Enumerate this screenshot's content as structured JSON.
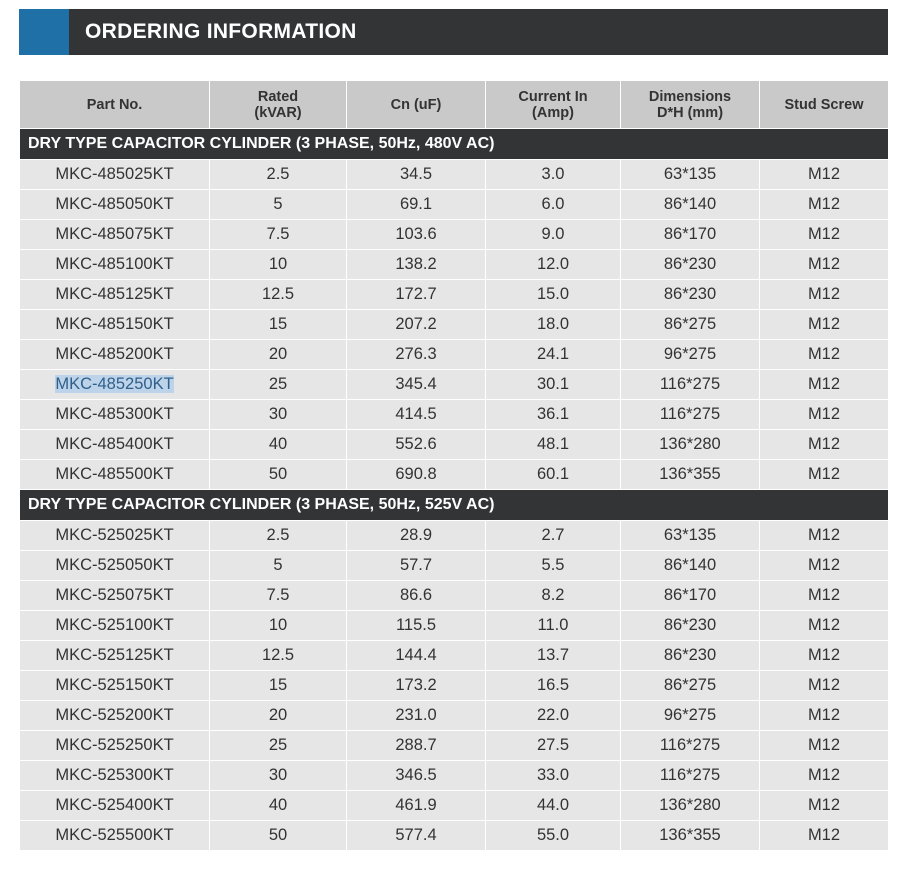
{
  "header": {
    "title": "ORDERING INFORMATION",
    "accent_color": "#1e70a6",
    "bar_color": "#333436"
  },
  "table": {
    "columns": [
      {
        "line1": "Part No.",
        "line2": ""
      },
      {
        "line1": "Rated",
        "line2": "(kVAR)"
      },
      {
        "line1": "Cn (uF)",
        "line2": ""
      },
      {
        "line1": "Current In",
        "line2": "(Amp)"
      },
      {
        "line1": "Dimensions",
        "line2": "D*H (mm)"
      },
      {
        "line1": "Stud Screw",
        "line2": ""
      }
    ],
    "sections": [
      {
        "title": "DRY TYPE CAPACITOR CYLINDER (3 PHASE, 50Hz, 480V AC)",
        "rows": [
          [
            "MKC-485025KT",
            "2.5",
            "34.5",
            "3.0",
            "63*135",
            "M12"
          ],
          [
            "MKC-485050KT",
            "5",
            "69.1",
            "6.0",
            "86*140",
            "M12"
          ],
          [
            "MKC-485075KT",
            "7.5",
            "103.6",
            "9.0",
            "86*170",
            "M12"
          ],
          [
            "MKC-485100KT",
            "10",
            "138.2",
            "12.0",
            "86*230",
            "M12"
          ],
          [
            "MKC-485125KT",
            "12.5",
            "172.7",
            "15.0",
            "86*230",
            "M12"
          ],
          [
            "MKC-485150KT",
            "15",
            "207.2",
            "18.0",
            "86*275",
            "M12"
          ],
          [
            "MKC-485200KT",
            "20",
            "276.3",
            "24.1",
            "96*275",
            "M12"
          ],
          [
            "MKC-485250KT",
            "25",
            "345.4",
            "30.1",
            "116*275",
            "M12"
          ],
          [
            "MKC-485300KT",
            "30",
            "414.5",
            "36.1",
            "116*275",
            "M12"
          ],
          [
            "MKC-485400KT",
            "40",
            "552.6",
            "48.1",
            "136*280",
            "M12"
          ],
          [
            "MKC-485500KT",
            "50",
            "690.8",
            "60.1",
            "136*355",
            "M12"
          ]
        ]
      },
      {
        "title": "DRY TYPE CAPACITOR CYLINDER (3 PHASE, 50Hz, 525V AC)",
        "rows": [
          [
            "MKC-525025KT",
            "2.5",
            "28.9",
            "2.7",
            "63*135",
            "M12"
          ],
          [
            "MKC-525050KT",
            "5",
            "57.7",
            "5.5",
            "86*140",
            "M12"
          ],
          [
            "MKC-525075KT",
            "7.5",
            "86.6",
            "8.2",
            "86*170",
            "M12"
          ],
          [
            "MKC-525100KT",
            "10",
            "115.5",
            "11.0",
            "86*230",
            "M12"
          ],
          [
            "MKC-525125KT",
            "12.5",
            "144.4",
            "13.7",
            "86*230",
            "M12"
          ],
          [
            "MKC-525150KT",
            "15",
            "173.2",
            "16.5",
            "86*275",
            "M12"
          ],
          [
            "MKC-525200KT",
            "20",
            "231.0",
            "22.0",
            "96*275",
            "M12"
          ],
          [
            "MKC-525250KT",
            "25",
            "288.7",
            "27.5",
            "116*275",
            "M12"
          ],
          [
            "MKC-525300KT",
            "30",
            "346.5",
            "33.0",
            "116*275",
            "M12"
          ],
          [
            "MKC-525400KT",
            "40",
            "461.9",
            "44.0",
            "136*280",
            "M12"
          ],
          [
            "MKC-525500KT",
            "50",
            "577.4",
            "55.0",
            "136*355",
            "M12"
          ]
        ]
      }
    ]
  }
}
